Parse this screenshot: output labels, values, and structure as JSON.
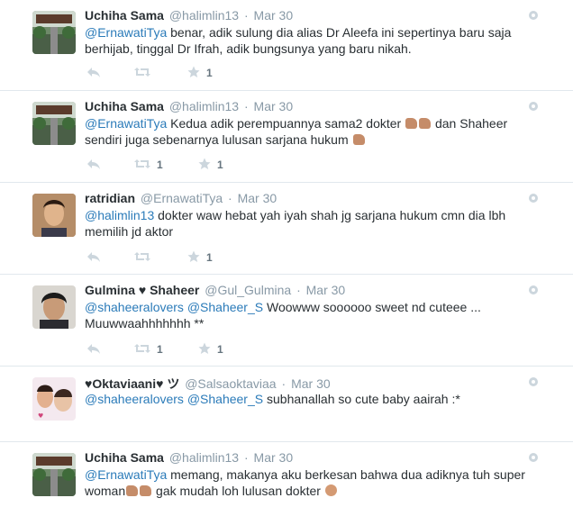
{
  "colors": {
    "link": "#2b7bb9",
    "muted": "#8899a6",
    "text": "#292f33",
    "divider": "#e1e8ed"
  },
  "tweets": [
    {
      "fullname": "Uchiha Sama",
      "username": "@halimlin13",
      "sep": "·",
      "time": "Mar 30",
      "mention": "@ErnawatiTya",
      "text_a": " benar, adik sulung dia alias Dr Aleefa ini sepertinya baru saja berhijab, tinggal Dr Ifrah, adik bungsunya yang baru nikah.",
      "retweets": "",
      "favorites": "1"
    },
    {
      "fullname": "Uchiha Sama",
      "username": "@halimlin13",
      "sep": "·",
      "time": "Mar 30",
      "mention": "@ErnawatiTya",
      "text_a": " Kedua adik perempuannya sama2 dokter ",
      "text_b": " dan Shaheer sendiri juga sebenarnya lulusan sarjana hukum ",
      "retweets": "1",
      "favorites": "1"
    },
    {
      "fullname": "ratridian",
      "username": "@ErnawatiTya",
      "sep": "·",
      "time": "Mar 30",
      "mention": "@halimlin13",
      "text_a": " dokter waw hebat yah iyah shah jg sarjana hukum cmn dia lbh memilih jd aktor",
      "retweets": "",
      "favorites": "1"
    },
    {
      "fullname": "Gulmina ♥ Shaheer",
      "username": "@Gul_Gulmina",
      "sep": "·",
      "time": "Mar 30",
      "mention": "@shaheeralovers",
      "mention2": "@Shaheer_S",
      "text_a": " Woowww soooooo sweet nd cuteee ... Muuwwaahhhhhhh **",
      "retweets": "1",
      "favorites": "1"
    },
    {
      "fullname": "♥Oktaviaani♥ ツ",
      "username": "@Salsaoktaviaa",
      "sep": "·",
      "time": "Mar 30",
      "mention": "@shaheeralovers",
      "mention2": "@Shaheer_S",
      "text_a": " subhanallah so cute baby aairah :*",
      "retweets": "",
      "favorites": ""
    },
    {
      "fullname": "Uchiha Sama",
      "username": "@halimlin13",
      "sep": "·",
      "time": "Mar 30",
      "mention": "@ErnawatiTya",
      "text_a": " memang, makanya aku berkesan bahwa dua adiknya tuh super woman",
      "text_b": " gak mudah loh lulusan dokter ",
      "retweets": "",
      "favorites": ""
    }
  ],
  "icons": {
    "reply": "reply-icon",
    "retweet": "retweet-icon",
    "favorite": "star-icon",
    "more": "gear-icon"
  }
}
